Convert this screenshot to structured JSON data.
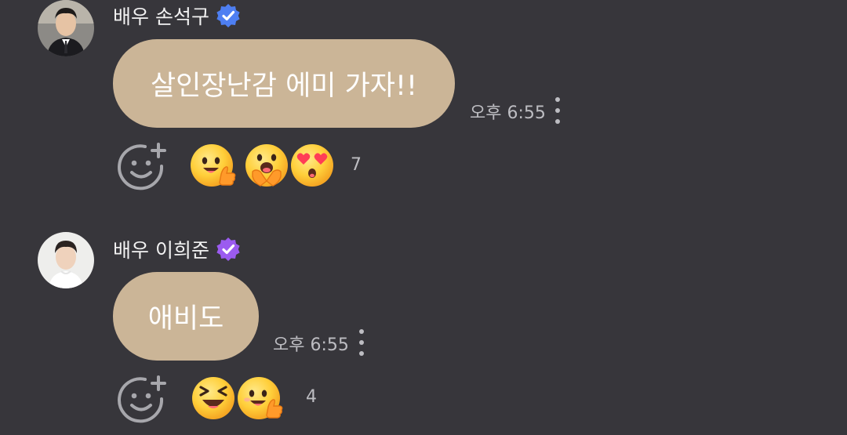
{
  "messages": [
    {
      "sender": "배우 손석구",
      "verified_color": "#4e7ff2",
      "text": "살인장난감 에미 가자!!",
      "time": "오후 6:55",
      "reactions": [
        "thumbs-up-emoji",
        "clapping-emoji",
        "heart-eyes-emoji"
      ],
      "reaction_count": "7"
    },
    {
      "sender": "배우 이희준",
      "verified_color": "#9b5bf0",
      "text": "애비도",
      "time": "오후 6:55",
      "reactions": [
        "laughing-emoji",
        "thumbs-up-emoji"
      ],
      "reaction_count": "4"
    }
  ],
  "colors": {
    "background": "#37363b",
    "bubble": "#cbb597",
    "meta_text": "#bdbdc2"
  },
  "icons": [
    "add-reaction-icon",
    "more-options-icon",
    "verified-badge-icon"
  ]
}
